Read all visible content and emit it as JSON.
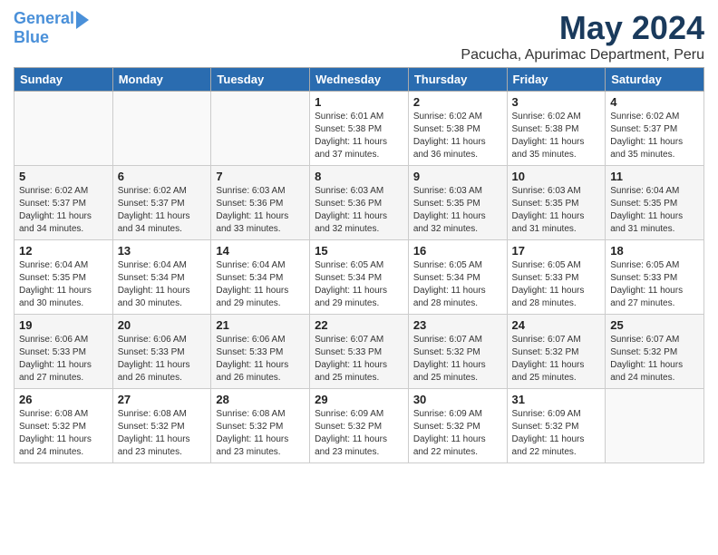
{
  "header": {
    "logo_line1": "General",
    "logo_line2": "Blue",
    "title": "May 2024",
    "subtitle": "Pacucha, Apurimac Department, Peru"
  },
  "weekdays": [
    "Sunday",
    "Monday",
    "Tuesday",
    "Wednesday",
    "Thursday",
    "Friday",
    "Saturday"
  ],
  "weeks": [
    [
      {
        "day": "",
        "info": ""
      },
      {
        "day": "",
        "info": ""
      },
      {
        "day": "",
        "info": ""
      },
      {
        "day": "1",
        "info": "Sunrise: 6:01 AM\nSunset: 5:38 PM\nDaylight: 11 hours\nand 37 minutes."
      },
      {
        "day": "2",
        "info": "Sunrise: 6:02 AM\nSunset: 5:38 PM\nDaylight: 11 hours\nand 36 minutes."
      },
      {
        "day": "3",
        "info": "Sunrise: 6:02 AM\nSunset: 5:38 PM\nDaylight: 11 hours\nand 35 minutes."
      },
      {
        "day": "4",
        "info": "Sunrise: 6:02 AM\nSunset: 5:37 PM\nDaylight: 11 hours\nand 35 minutes."
      }
    ],
    [
      {
        "day": "5",
        "info": "Sunrise: 6:02 AM\nSunset: 5:37 PM\nDaylight: 11 hours\nand 34 minutes."
      },
      {
        "day": "6",
        "info": "Sunrise: 6:02 AM\nSunset: 5:37 PM\nDaylight: 11 hours\nand 34 minutes."
      },
      {
        "day": "7",
        "info": "Sunrise: 6:03 AM\nSunset: 5:36 PM\nDaylight: 11 hours\nand 33 minutes."
      },
      {
        "day": "8",
        "info": "Sunrise: 6:03 AM\nSunset: 5:36 PM\nDaylight: 11 hours\nand 32 minutes."
      },
      {
        "day": "9",
        "info": "Sunrise: 6:03 AM\nSunset: 5:35 PM\nDaylight: 11 hours\nand 32 minutes."
      },
      {
        "day": "10",
        "info": "Sunrise: 6:03 AM\nSunset: 5:35 PM\nDaylight: 11 hours\nand 31 minutes."
      },
      {
        "day": "11",
        "info": "Sunrise: 6:04 AM\nSunset: 5:35 PM\nDaylight: 11 hours\nand 31 minutes."
      }
    ],
    [
      {
        "day": "12",
        "info": "Sunrise: 6:04 AM\nSunset: 5:35 PM\nDaylight: 11 hours\nand 30 minutes."
      },
      {
        "day": "13",
        "info": "Sunrise: 6:04 AM\nSunset: 5:34 PM\nDaylight: 11 hours\nand 30 minutes."
      },
      {
        "day": "14",
        "info": "Sunrise: 6:04 AM\nSunset: 5:34 PM\nDaylight: 11 hours\nand 29 minutes."
      },
      {
        "day": "15",
        "info": "Sunrise: 6:05 AM\nSunset: 5:34 PM\nDaylight: 11 hours\nand 29 minutes."
      },
      {
        "day": "16",
        "info": "Sunrise: 6:05 AM\nSunset: 5:34 PM\nDaylight: 11 hours\nand 28 minutes."
      },
      {
        "day": "17",
        "info": "Sunrise: 6:05 AM\nSunset: 5:33 PM\nDaylight: 11 hours\nand 28 minutes."
      },
      {
        "day": "18",
        "info": "Sunrise: 6:05 AM\nSunset: 5:33 PM\nDaylight: 11 hours\nand 27 minutes."
      }
    ],
    [
      {
        "day": "19",
        "info": "Sunrise: 6:06 AM\nSunset: 5:33 PM\nDaylight: 11 hours\nand 27 minutes."
      },
      {
        "day": "20",
        "info": "Sunrise: 6:06 AM\nSunset: 5:33 PM\nDaylight: 11 hours\nand 26 minutes."
      },
      {
        "day": "21",
        "info": "Sunrise: 6:06 AM\nSunset: 5:33 PM\nDaylight: 11 hours\nand 26 minutes."
      },
      {
        "day": "22",
        "info": "Sunrise: 6:07 AM\nSunset: 5:33 PM\nDaylight: 11 hours\nand 25 minutes."
      },
      {
        "day": "23",
        "info": "Sunrise: 6:07 AM\nSunset: 5:32 PM\nDaylight: 11 hours\nand 25 minutes."
      },
      {
        "day": "24",
        "info": "Sunrise: 6:07 AM\nSunset: 5:32 PM\nDaylight: 11 hours\nand 25 minutes."
      },
      {
        "day": "25",
        "info": "Sunrise: 6:07 AM\nSunset: 5:32 PM\nDaylight: 11 hours\nand 24 minutes."
      }
    ],
    [
      {
        "day": "26",
        "info": "Sunrise: 6:08 AM\nSunset: 5:32 PM\nDaylight: 11 hours\nand 24 minutes."
      },
      {
        "day": "27",
        "info": "Sunrise: 6:08 AM\nSunset: 5:32 PM\nDaylight: 11 hours\nand 23 minutes."
      },
      {
        "day": "28",
        "info": "Sunrise: 6:08 AM\nSunset: 5:32 PM\nDaylight: 11 hours\nand 23 minutes."
      },
      {
        "day": "29",
        "info": "Sunrise: 6:09 AM\nSunset: 5:32 PM\nDaylight: 11 hours\nand 23 minutes."
      },
      {
        "day": "30",
        "info": "Sunrise: 6:09 AM\nSunset: 5:32 PM\nDaylight: 11 hours\nand 22 minutes."
      },
      {
        "day": "31",
        "info": "Sunrise: 6:09 AM\nSunset: 5:32 PM\nDaylight: 11 hours\nand 22 minutes."
      },
      {
        "day": "",
        "info": ""
      }
    ]
  ]
}
